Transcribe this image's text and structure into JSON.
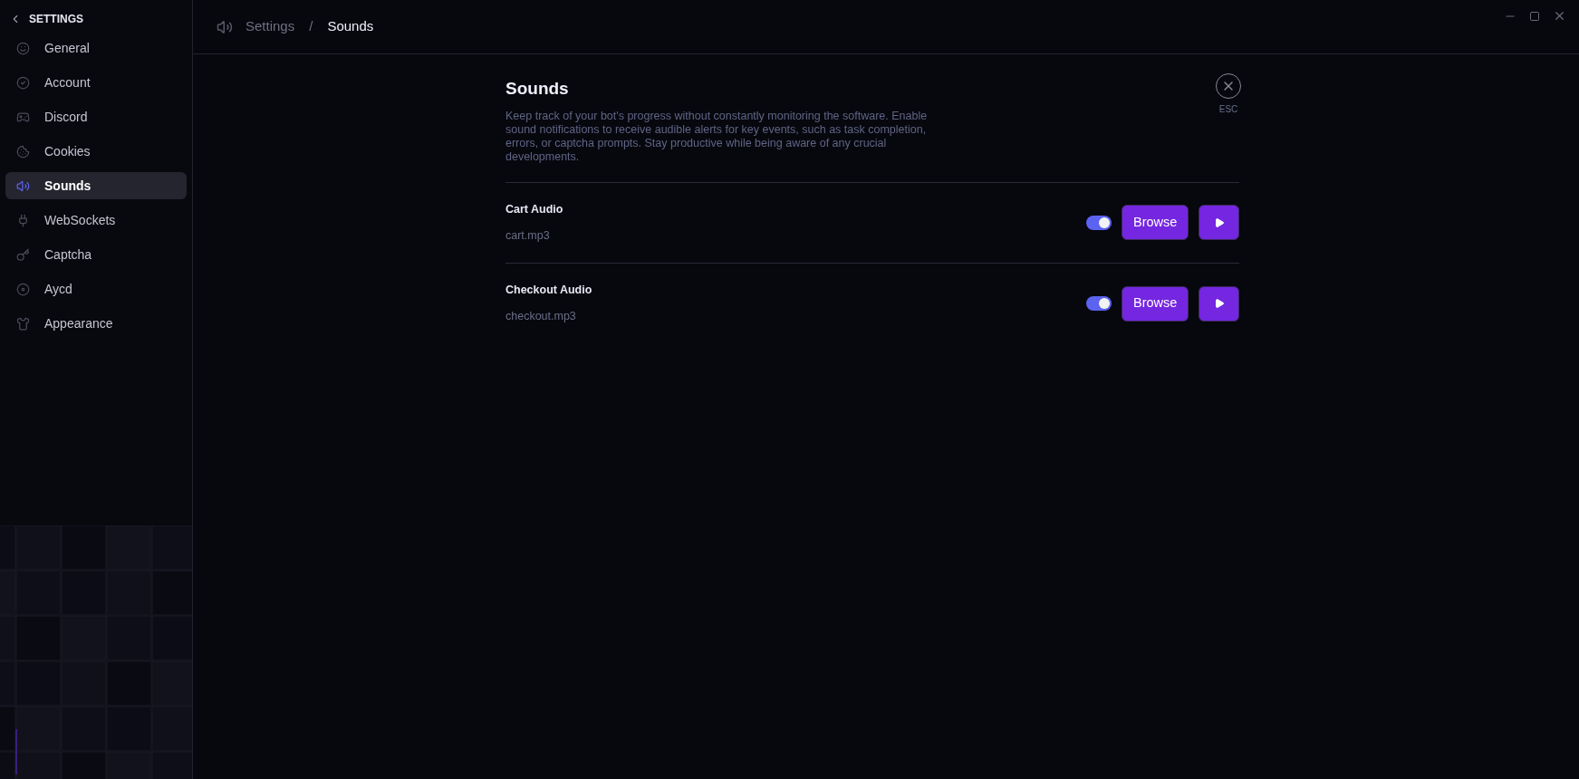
{
  "sidebar": {
    "title": "SETTINGS",
    "items": [
      {
        "label": "General",
        "kind": "general",
        "selected": false
      },
      {
        "label": "Account",
        "kind": "account",
        "selected": false
      },
      {
        "label": "Discord",
        "kind": "discord",
        "selected": false
      },
      {
        "label": "Cookies",
        "kind": "cookies",
        "selected": false
      },
      {
        "label": "Sounds",
        "kind": "sounds",
        "selected": true
      },
      {
        "label": "WebSockets",
        "kind": "websockets",
        "selected": false
      },
      {
        "label": "Captcha",
        "kind": "captcha",
        "selected": false
      },
      {
        "label": "Aycd",
        "kind": "aycd",
        "selected": false
      },
      {
        "label": "Appearance",
        "kind": "appearance",
        "selected": false
      }
    ]
  },
  "breadcrumb": {
    "parent": "Settings",
    "separator": "/",
    "current": "Sounds"
  },
  "page": {
    "title": "Sounds",
    "description": "Keep track of your bot's progress without constantly monitoring the software. Enable sound notifications to receive audible alerts for key events, such as task completion, errors, or captcha prompts. Stay productive while being aware of any crucial developments.",
    "close_label": "ESC"
  },
  "sounds": [
    {
      "name": "Cart Audio",
      "file": "cart.mp3",
      "on": true,
      "browse": "Browse"
    },
    {
      "name": "Checkout Audio",
      "file": "checkout.mp3",
      "on": true,
      "browse": "Browse"
    }
  ]
}
